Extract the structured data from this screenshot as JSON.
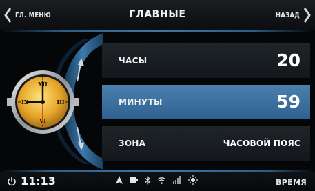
{
  "header": {
    "back_label": "ГЛ. МЕНЮ",
    "title": "ГЛАВНЫЕ",
    "next_label": "НАЗАД"
  },
  "settings": [
    {
      "label": "ЧАСЫ",
      "value": "20"
    },
    {
      "label": "МИНУТЫ",
      "value": "59"
    },
    {
      "label": "ЗОНА",
      "value": "ЧАСОВОЙ ПОЯС"
    }
  ],
  "clock_face": {
    "numerals": [
      "XII",
      "III",
      "VI",
      "IX"
    ]
  },
  "statusbar": {
    "time": "11:13",
    "icons": [
      "navigation-icon",
      "battery-icon",
      "bluetooth-icon",
      "wifi-icon",
      "signal-icon",
      "brightness-icon"
    ],
    "mode_label": "ВРЕМЯ"
  },
  "colors": {
    "accent": "#3a78aa",
    "selected_row": "#4a7fae",
    "row_bg": "#1b1f23",
    "clock_gold": "#e0a82e"
  }
}
